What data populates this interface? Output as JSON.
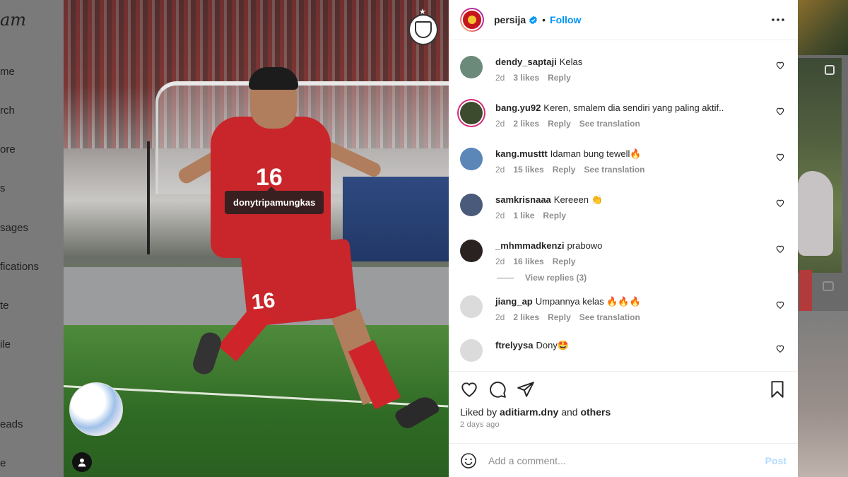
{
  "background": {
    "logo_fragment": "am",
    "nav_fragments": [
      "me",
      "rch",
      "ore",
      "s",
      "sages",
      "fications",
      "te",
      "ile",
      "eads",
      "e"
    ]
  },
  "media": {
    "user_tag": "donytripamungkas",
    "shirt_number": "16",
    "shorts_number": "16"
  },
  "post": {
    "username": "persija",
    "verified": true,
    "separator": "•",
    "follow_label": "Follow",
    "more_icon": "more-horizontal-icon"
  },
  "comments": [
    {
      "user": "dendy_saptaji",
      "text": "Kelas",
      "age": "2d",
      "likes": "3 likes",
      "reply": "Reply",
      "translation": "",
      "avatar_color": "#6c8a7a"
    },
    {
      "user": "bang.yu92",
      "text": "Keren, smalem dia sendiri yang paling aktif..",
      "age": "2d",
      "likes": "2 likes",
      "reply": "Reply",
      "translation": "See translation",
      "avatar_color": "#3c4a2e"
    },
    {
      "user": "kang.musttt",
      "text": "Idaman bung tewell🔥",
      "age": "2d",
      "likes": "15 likes",
      "reply": "Reply",
      "translation": "See translation",
      "avatar_color": "#5a86b8"
    },
    {
      "user": "samkrisnaaa",
      "text": "Kereeen 👏",
      "age": "2d",
      "likes": "1 like",
      "reply": "Reply",
      "translation": "",
      "avatar_color": "#4a5a7a"
    },
    {
      "user": "_mhmmadkenzi",
      "text": "prabowo",
      "age": "2d",
      "likes": "16 likes",
      "reply": "Reply",
      "translation": "",
      "avatar_color": "#2a2220"
    },
    {
      "user": "jiang_ap",
      "text": "Umpannya kelas 🔥🔥🔥",
      "age": "2d",
      "likes": "2 likes",
      "reply": "Reply",
      "translation": "See translation",
      "avatar_color": "#dbdbdb"
    },
    {
      "user": "ftrelyysa",
      "text": "Dony🤩",
      "age": "",
      "likes": "",
      "reply": "",
      "translation": "",
      "avatar_color": "#dbdbdb"
    }
  ],
  "view_replies": "View replies (3)",
  "actions": {
    "liked_by_prefix": "Liked by",
    "liked_by_user": "aditiarm.dny",
    "liked_by_and": "and",
    "liked_by_others": "others",
    "posted_ago": "2 days ago"
  },
  "add_comment": {
    "placeholder": "Add a comment...",
    "post_label": "Post"
  },
  "colors": {
    "accent": "#0095f6",
    "post_disabled": "#b3dbff",
    "verified_badge": "#0095f6"
  }
}
